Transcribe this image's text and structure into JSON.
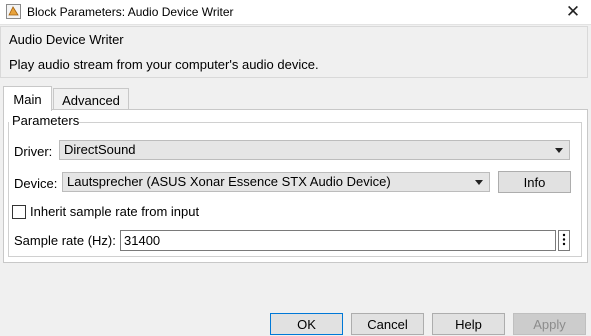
{
  "window": {
    "title": "Block Parameters: Audio Device Writer",
    "close_icon": "close-icon"
  },
  "header": {
    "title": "Audio Device Writer",
    "description": "Play audio stream from your computer's audio device."
  },
  "tabs": [
    {
      "label": "Main",
      "selected": true
    },
    {
      "label": "Advanced",
      "selected": false
    }
  ],
  "parameters": {
    "group_label": "Parameters",
    "driver_label": "Driver:",
    "driver_value": "DirectSound",
    "device_label": "Device:",
    "device_value": "Lautsprecher (ASUS Xonar Essence STX Audio Device)",
    "info_button": "Info",
    "inherit_label": "Inherit sample rate from input",
    "inherit_checked": false,
    "sample_rate_label": "Sample rate (Hz):",
    "sample_rate_value": "31400"
  },
  "footer": {
    "ok": "OK",
    "cancel": "Cancel",
    "help": "Help",
    "apply": "Apply"
  },
  "colors": {
    "ok_border": "#0078d7",
    "panel_bg": "#ffffff",
    "window_bg": "#f0f0f0"
  }
}
